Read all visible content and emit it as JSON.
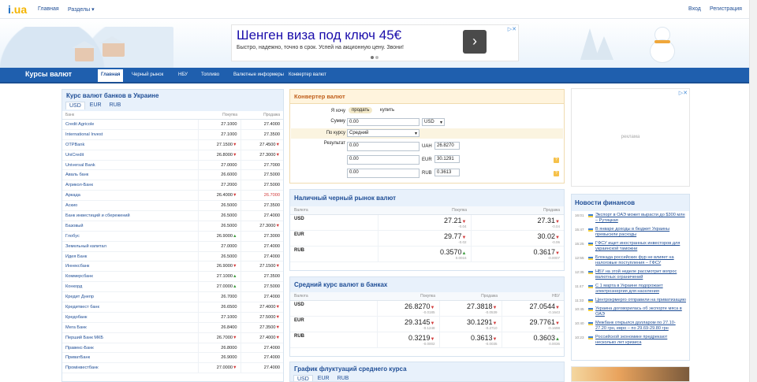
{
  "topbar": {
    "logo_main": "i",
    "logo_rest": ".ua",
    "links": [
      "Главная",
      "Разделы ▾"
    ],
    "login": "Вход",
    "register": "Регистрация"
  },
  "ad_top": {
    "title": "Шенген виза под ключ 45€",
    "desc": "Быстро, надежно, точно в срок. Успей на акционную цену. Звони!",
    "arrow": "›",
    "close": "▷✕"
  },
  "nav": {
    "title": "Курсы валют",
    "items": [
      "Главная",
      "Черный рынок",
      "НБУ",
      "Топливо",
      "Валютные информеры",
      "Конвертер валют"
    ]
  },
  "banks": {
    "title": "Курс валют банков в Украине",
    "tabs": [
      "USD",
      "EUR",
      "RUB"
    ],
    "headers": [
      "Банк",
      "Покупка",
      "Продажа"
    ],
    "rows": [
      {
        "name": "Credit Agricole",
        "buy": "27.1000",
        "sell": "27.4000",
        "bt": "",
        "st": ""
      },
      {
        "name": "International Invest",
        "buy": "27.1000",
        "sell": "27.3500",
        "bt": "",
        "st": ""
      },
      {
        "name": "OTPBank",
        "buy": "27.1500",
        "sell": "27.4500",
        "bt": "▼",
        "st": "▼"
      },
      {
        "name": "UniCredit",
        "buy": "26.8000",
        "sell": "27.3000",
        "bt": "▼",
        "st": "▼"
      },
      {
        "name": "Universal Bank",
        "buy": "27.0000",
        "sell": "27.7000",
        "bt": "",
        "st": ""
      },
      {
        "name": "Аваль банк",
        "buy": "26.6000",
        "sell": "27.5000",
        "bt": "",
        "st": ""
      },
      {
        "name": "Агрикол-Банк",
        "buy": "27.2000",
        "sell": "27.5000",
        "bt": "",
        "st": ""
      },
      {
        "name": "Аркада",
        "buy": "26.4000",
        "sell": "26.7000",
        "bt": "▼",
        "st": "",
        "red": true
      },
      {
        "name": "Аскио",
        "buy": "26.5000",
        "sell": "27.3500",
        "bt": "",
        "st": ""
      },
      {
        "name": "Банк инвестиций и сбережений",
        "buy": "26.5000",
        "sell": "27.4000",
        "bt": "",
        "st": ""
      },
      {
        "name": "Базовый",
        "buy": "26.5000",
        "sell": "27.3000",
        "bt": "",
        "st": "▼"
      },
      {
        "name": "Глобус",
        "buy": "26.9000",
        "sell": "27.3000",
        "bt": "▲",
        "st": ""
      },
      {
        "name": "Земельный капитал",
        "buy": "27.0000",
        "sell": "27.4000",
        "bt": "",
        "st": ""
      },
      {
        "name": "Идея Банк",
        "buy": "26.5000",
        "sell": "27.4000",
        "bt": "",
        "st": ""
      },
      {
        "name": "Иннексбанк",
        "buy": "26.9000",
        "sell": "27.1500",
        "bt": "▼",
        "st": "▼"
      },
      {
        "name": "Коммерсбанк",
        "buy": "27.1000",
        "sell": "27.3500",
        "bt": "▲",
        "st": ""
      },
      {
        "name": "Конкорд",
        "buy": "27.0000",
        "sell": "27.5000",
        "bt": "▲",
        "st": ""
      },
      {
        "name": "Кредит Днепр",
        "buy": "26.7000",
        "sell": "27.4000",
        "bt": "",
        "st": ""
      },
      {
        "name": "Кредитвест банк",
        "buy": "26.6500",
        "sell": "27.4000",
        "bt": "",
        "st": "▼"
      },
      {
        "name": "Кредобанк",
        "buy": "27.1000",
        "sell": "27.5000",
        "bt": "",
        "st": "▼"
      },
      {
        "name": "Мега Банк",
        "buy": "26.8400",
        "sell": "27.3500",
        "bt": "",
        "st": "▼"
      },
      {
        "name": "Перший Банк МКБ",
        "buy": "26.7000",
        "sell": "27.4000",
        "bt": "▼",
        "st": "▼"
      },
      {
        "name": "Правекс-Банк",
        "buy": "26.8000",
        "sell": "27.4000",
        "bt": "",
        "st": ""
      },
      {
        "name": "ПриватБанк",
        "buy": "26.9000",
        "sell": "27.4000",
        "bt": "",
        "st": ""
      },
      {
        "name": "Промінвестбанк",
        "buy": "27.0000",
        "sell": "27.4000",
        "bt": "▼",
        "st": ""
      }
    ]
  },
  "converter": {
    "title": "Конвертер валют",
    "want_label": "Я хочу",
    "opt_sell": "продать",
    "opt_buy": "купить",
    "sum_label": "Сумму",
    "sum_value": "0.00",
    "sum_currency": "USD",
    "rate_label": "По курсу",
    "rate_value": "Средний",
    "result_label": "Результат",
    "results": [
      {
        "value": "0.00",
        "cur": "UAH",
        "rate": "26.8270"
      },
      {
        "value": "0.00",
        "cur": "EUR",
        "rate": "30.1291"
      },
      {
        "value": "0.00",
        "cur": "RUB",
        "rate": "0.3613"
      }
    ],
    "help": "?"
  },
  "black_market": {
    "title": "Наличный черный рынок валют",
    "headers": [
      "Валюта",
      "Покупка",
      "Продажа"
    ],
    "rows": [
      {
        "cur": "USD",
        "buy": "27.21",
        "buy_tr": "▼",
        "buy_d": "-0.04",
        "sell": "27.31",
        "sell_tr": "▼",
        "sell_d": "-0.04"
      },
      {
        "cur": "EUR",
        "buy": "29.77",
        "buy_tr": "▼",
        "buy_d": "-0.02",
        "sell": "30.02",
        "sell_tr": "▼",
        "sell_d": "-0.06"
      },
      {
        "cur": "RUB",
        "buy": "0.3570",
        "buy_tr": "▲",
        "buy_d": "0.0016",
        "sell": "0.3617",
        "sell_tr": "▼",
        "sell_d": "-0.0007"
      }
    ]
  },
  "avg_rates": {
    "title": "Средний курс валют в банках",
    "headers": [
      "Валюта",
      "Покупка",
      "Продажа",
      "НБУ"
    ],
    "rows": [
      {
        "cur": "USD",
        "buy": "26.8270",
        "buy_tr": "▼",
        "buy_d": "-0.0185",
        "sell": "27.3818",
        "sell_tr": "▼",
        "sell_d": "-0.0539",
        "nbu": "27.0544",
        "nbu_tr": "▼",
        "nbu_d": "-0.1643"
      },
      {
        "cur": "EUR",
        "buy": "29.3145",
        "buy_tr": "▼",
        "buy_d": "-0.1248",
        "sell": "30.1291",
        "sell_tr": "▼",
        "sell_d": "-0.2710",
        "nbu": "29.7761",
        "nbu_tr": "▼",
        "nbu_d": "-0.1698"
      },
      {
        "cur": "RUB",
        "buy": "0.3219",
        "buy_tr": "▼",
        "buy_d": "-0.0002",
        "sell": "0.3613",
        "sell_tr": "▼",
        "sell_d": "-0.0035",
        "nbu": "0.3603",
        "nbu_tr": "▲",
        "nbu_d": "0.0036"
      }
    ]
  },
  "fluct": {
    "title": "График флуктуаций среднего курса",
    "tabs": [
      "USD",
      "EUR",
      "RUB"
    ]
  },
  "ad_right": {
    "label": "реклама",
    "close": "▷✕"
  },
  "news": {
    "title": "Новости финансов",
    "items": [
      {
        "time": "16:01",
        "text": "Экспорт в ОАЭ может вырасти до $300 млн – Рутицкая"
      },
      {
        "time": "15:47",
        "text": "В январе доходы в бюджет Украины превысили расходы"
      },
      {
        "time": "15:25",
        "text": "ГФСУ ищет иностранных инвесторов для украинской таможни"
      },
      {
        "time": "12:55",
        "text": "Блокада российских фур не влияет на налоговые поступления – ГФСУ"
      },
      {
        "time": "12:35",
        "text": "НБУ на этой неделе рассмотрит вопрос валютных ограничений"
      },
      {
        "time": "11:47",
        "text": "С 1 марта в Украине подорожает электроэнергия для населения"
      },
      {
        "time": "11:33",
        "text": "Центрокрмерго отправили на приватизацию"
      },
      {
        "time": "10:45",
        "text": "Украина договорилась об экспорте мяса в ОАЭ"
      },
      {
        "time": "10:40",
        "text": "Межбанк открылся долларом по 27.10-27.20 грн, евро – по 29.69-29.80 грн"
      },
      {
        "time": "10:23",
        "text": "Российской экономике предрекают несколько лет кризиса"
      }
    ]
  }
}
